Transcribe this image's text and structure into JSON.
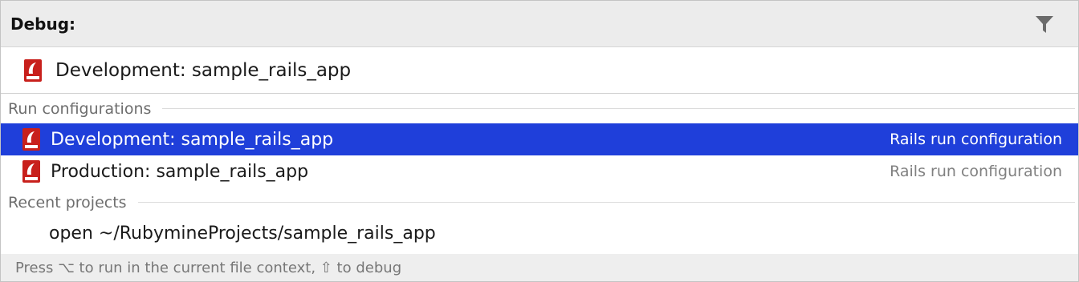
{
  "header": {
    "title": "Debug:",
    "filter_icon": "filter-icon"
  },
  "search": {
    "value": "Development: sample_rails_app",
    "icon": "rails-icon"
  },
  "sections": {
    "run_configurations": {
      "label": "Run configurations",
      "items": [
        {
          "label": "Development: sample_rails_app",
          "type": "Rails run configuration",
          "icon": "rails-icon",
          "selected": true
        },
        {
          "label": "Production: sample_rails_app",
          "type": "Rails run configuration",
          "icon": "rails-icon",
          "selected": false
        }
      ]
    },
    "recent_projects": {
      "label": "Recent projects",
      "items": [
        {
          "label": "open ~/RubymineProjects/sample_rails_app"
        }
      ]
    }
  },
  "footer": {
    "hint": "Press ⌥ to run in the current file context, ⇧ to debug"
  },
  "colors": {
    "selection": "#1f3fda",
    "header_bg": "#ececec",
    "rails_red": "#c8201c"
  }
}
